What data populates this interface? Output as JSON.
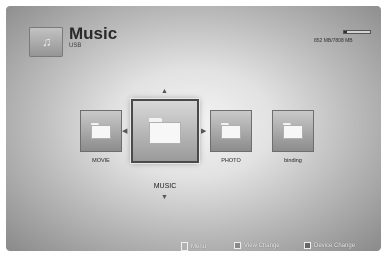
{
  "header": {
    "title": "Music",
    "subtitle": "USB",
    "icon": "music-note-icon",
    "storage_text": "852 MB/7808 MB",
    "storage_fraction": 0.11
  },
  "items": [
    {
      "label": "MOVIE",
      "icon": "folder-icon"
    },
    {
      "label": "MUSIC",
      "icon": "folder-icon",
      "selected": true
    },
    {
      "label": "PHOTO",
      "icon": "folder-icon"
    },
    {
      "label": "binding",
      "icon": "folder-icon"
    }
  ],
  "footer": {
    "menu_label": "Menu",
    "view_change_label": "View Change",
    "device_change_label": "Device Change"
  },
  "colors": {
    "background_center": "#f4f4f4",
    "background_edge": "#8a8a8a",
    "selection_border": "#4a4a4a"
  }
}
